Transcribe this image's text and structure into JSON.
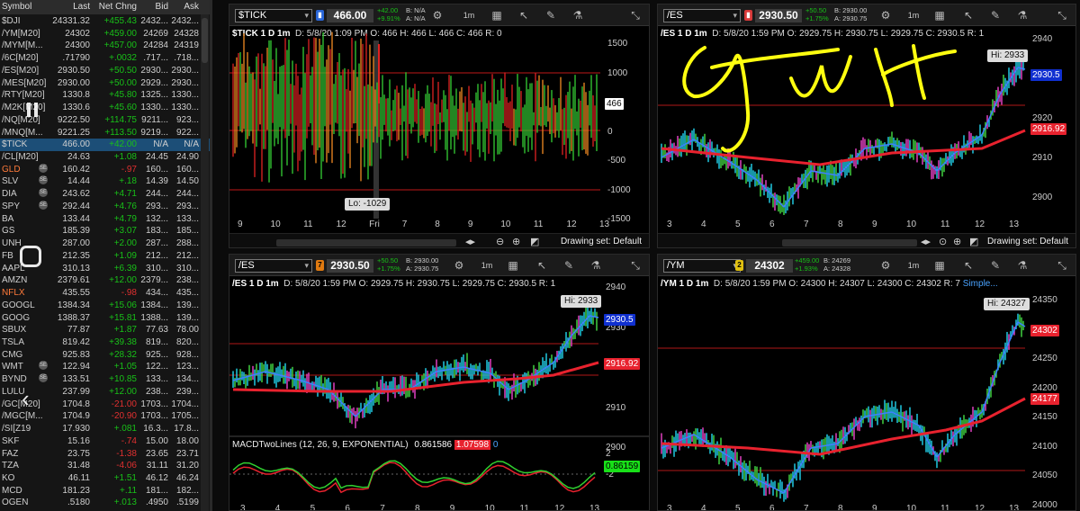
{
  "watchlist": {
    "headers": [
      "Symbol",
      "Last",
      "Net Chng",
      "Bid",
      "Ask"
    ],
    "rows": [
      [
        "$DJI",
        "24331.32",
        "+455.43",
        "2432...",
        "2432..."
      ],
      [
        "/YM[M20]",
        "24302",
        "+459.00",
        "24269",
        "24328"
      ],
      [
        "/MYM[M...",
        "24300",
        "+457.00",
        "24284",
        "24319"
      ],
      [
        "/6C[M20]",
        ".71790",
        "+.0032",
        ".717...",
        ".718..."
      ],
      [
        "/ES[M20]",
        "2930.50",
        "+50.50",
        "2930...",
        "2930..."
      ],
      [
        "/MES[M20]",
        "2930.00",
        "+50.00",
        "2929...",
        "2930..."
      ],
      [
        "/RTY[M20]",
        "1330.8",
        "+45.80",
        "1325...",
        "1330..."
      ],
      [
        "/M2K[M20]",
        "1330.6",
        "+45.60",
        "1330...",
        "1330..."
      ],
      [
        "/NQ[M20]",
        "9222.50",
        "+114.75",
        "9211...",
        "923..."
      ],
      [
        "/MNQ[M...",
        "9221.25",
        "+113.50",
        "9219...",
        "922..."
      ],
      [
        "$TICK",
        "466.00",
        "+42.00",
        "N/A",
        "N/A"
      ],
      [
        "/CL[M20]",
        "24.63",
        "+1.08",
        "24.45",
        "24.90"
      ],
      [
        "GLD",
        "160.42",
        "-.97",
        "160...",
        "160..."
      ],
      [
        "SLV",
        "14.44",
        "+.18",
        "14.39",
        "14.50"
      ],
      [
        "DIA",
        "243.62",
        "+4.71",
        "244...",
        "244..."
      ],
      [
        "SPY",
        "292.44",
        "+4.76",
        "293...",
        "293..."
      ],
      [
        "BA",
        "133.44",
        "+4.79",
        "132...",
        "133..."
      ],
      [
        "GS",
        "185.39",
        "+3.07",
        "183...",
        "185..."
      ],
      [
        "UNH",
        "287.00",
        "+2.00",
        "287...",
        "288..."
      ],
      [
        "FB",
        "212.35",
        "+1.09",
        "212...",
        "212..."
      ],
      [
        "AAPL",
        "310.13",
        "+6.39",
        "310...",
        "310..."
      ],
      [
        "AMZN",
        "2379.61",
        "+12.00",
        "2379...",
        "238..."
      ],
      [
        "NFLX",
        "435.55",
        "-.98",
        "434...",
        "435..."
      ],
      [
        "GOOGL",
        "1384.34",
        "+15.06",
        "1384...",
        "139..."
      ],
      [
        "GOOG",
        "1388.37",
        "+15.81",
        "1388...",
        "139..."
      ],
      [
        "SBUX",
        "77.87",
        "+1.87",
        "77.63",
        "78.00"
      ],
      [
        "TSLA",
        "819.42",
        "+39.38",
        "819...",
        "820..."
      ],
      [
        "CMG",
        "925.83",
        "+28.32",
        "925...",
        "928..."
      ],
      [
        "WMT",
        "122.94",
        "+1.05",
        "122...",
        "123..."
      ],
      [
        "BYND",
        "133.51",
        "+10.85",
        "133...",
        "134..."
      ],
      [
        "LULU",
        "237.99",
        "+12.00",
        "238...",
        "239..."
      ],
      [
        "/GC[M20]",
        "1704.8",
        "-21.00",
        "1703...",
        "1704..."
      ],
      [
        "/MGC[M...",
        "1704.9",
        "-20.90",
        "1703...",
        "1705..."
      ],
      [
        "/SI[Z19",
        "17.930",
        "+.081",
        "16.3...",
        "17.8..."
      ],
      [
        "SKF",
        "15.16",
        "-.74",
        "15.00",
        "18.00"
      ],
      [
        "FAZ",
        "23.75",
        "-1.38",
        "23.65",
        "23.71"
      ],
      [
        "TZA",
        "31.48",
        "-4.06",
        "31.11",
        "31.20"
      ],
      [
        "KO",
        "46.11",
        "+1.51",
        "46.12",
        "46.24"
      ],
      [
        "MCD",
        "181.23",
        "+.11",
        "181...",
        "182..."
      ],
      [
        "OGEN",
        ".5180",
        "+.013",
        ".4950",
        ".5199"
      ]
    ],
    "icons": {
      "12": "SE",
      "13": "SE",
      "14": "SE",
      "15": "SE",
      "28": "SE",
      "29": "SE"
    }
  },
  "panels": {
    "tick": {
      "symbol": "$TICK",
      "price": "466.00",
      "change": "+42.00",
      "change_pct": "+9.91%",
      "bid": "B: N/A",
      "ask": "A: N/A",
      "timeframe": "1m",
      "header": "$TICK 1 D 1m",
      "details": "D: 5/8/20 1:09 PM  O: 466  H: 466  L: 466  C: 466  R: 0",
      "y_ticks": [
        "1500",
        "1000",
        "500",
        "0",
        "-500",
        "-1000",
        "-1500"
      ],
      "x_ticks": [
        "9",
        "10",
        "11",
        "12",
        "Fri",
        "7",
        "8",
        "9",
        "10",
        "11",
        "12",
        "13"
      ],
      "low_label": "Lo: -1029",
      "last_tag": "466",
      "drawing_set": "Drawing set: Default"
    },
    "es_top": {
      "symbol": "/ES",
      "price": "2930.50",
      "change": "+50.50",
      "change_pct": "+1.75%",
      "bid": "B: 2930.00",
      "ask": "A: 2930.75",
      "timeframe": "1m",
      "header": "/ES 1 D 1m",
      "details": "D: 5/8/20 1:59 PM  O: 2929.75  H: 2930.75  L: 2929.75  C: 2930.5  R: 1",
      "y_ticks": [
        "2940",
        "2930",
        "2920",
        "2910",
        "2900"
      ],
      "x_ticks": [
        "3",
        "4",
        "5",
        "6",
        "7",
        "8",
        "9",
        "10",
        "11",
        "12",
        "13"
      ],
      "high_label": "Hi: 2933",
      "last_tag": "2930.5",
      "ma_tag": "2916.92",
      "drawing_set": "Drawing set: Default"
    },
    "es_bottom": {
      "symbol": "/ES",
      "price": "2930.50",
      "change": "+50.50",
      "change_pct": "+1.75%",
      "bid": "B: 2930.00",
      "ask": "A: 2930.75",
      "timeframe": "1m",
      "header": "/ES 1 D 1m",
      "details": "D: 5/8/20 1:59 PM  O: 2929.75  H: 2930.75  L: 2929.75  C: 2930.5  R: 1",
      "y_ticks": [
        "2940",
        "2930",
        "2920",
        "2910",
        "2900"
      ],
      "high_label": "Hi: 2933",
      "last_tag": "2930.5",
      "ma_tag": "2916.92",
      "macd_header": "MACDTwoLines (12, 26, 9, EXPONENTIAL)",
      "macd_v1": "0.861586",
      "macd_v2": "1.07598",
      "macd_v3": "0",
      "macd_ticks": [
        "2",
        "0",
        "-2"
      ],
      "macd_tag": "0.86159",
      "x_ticks": [
        "3",
        "4",
        "5",
        "6",
        "7",
        "8",
        "9",
        "10",
        "11",
        "12",
        "13"
      ]
    },
    "ym": {
      "symbol": "/YM",
      "price": "24302",
      "change": "+459.00",
      "change_pct": "+1.93%",
      "bid": "B: 24269",
      "ask": "A: 24328",
      "timeframe": "1m",
      "header": "/YM 1 D 1m",
      "details": "D: 5/8/20 1:59 PM  O: 24300  H: 24307  L: 24300  C: 24302  R: 7",
      "link": "Simple...",
      "y_ticks": [
        "24350",
        "24300",
        "24250",
        "24200",
        "24150",
        "24100",
        "24050",
        "24000"
      ],
      "x_ticks": [
        "3",
        "4",
        "5",
        "6",
        "7",
        "8",
        "9",
        "10",
        "11",
        "12",
        "13"
      ],
      "high_label": "Hi: 24327",
      "last_tag": "24302",
      "ma_tag": "24177"
    }
  },
  "colors": {
    "up": "#18c018",
    "down": "#e03030",
    "ma": "#e8222e",
    "trend": "#3f7fff",
    "selected": "#1c4e77",
    "annotation": "#ffff00"
  }
}
